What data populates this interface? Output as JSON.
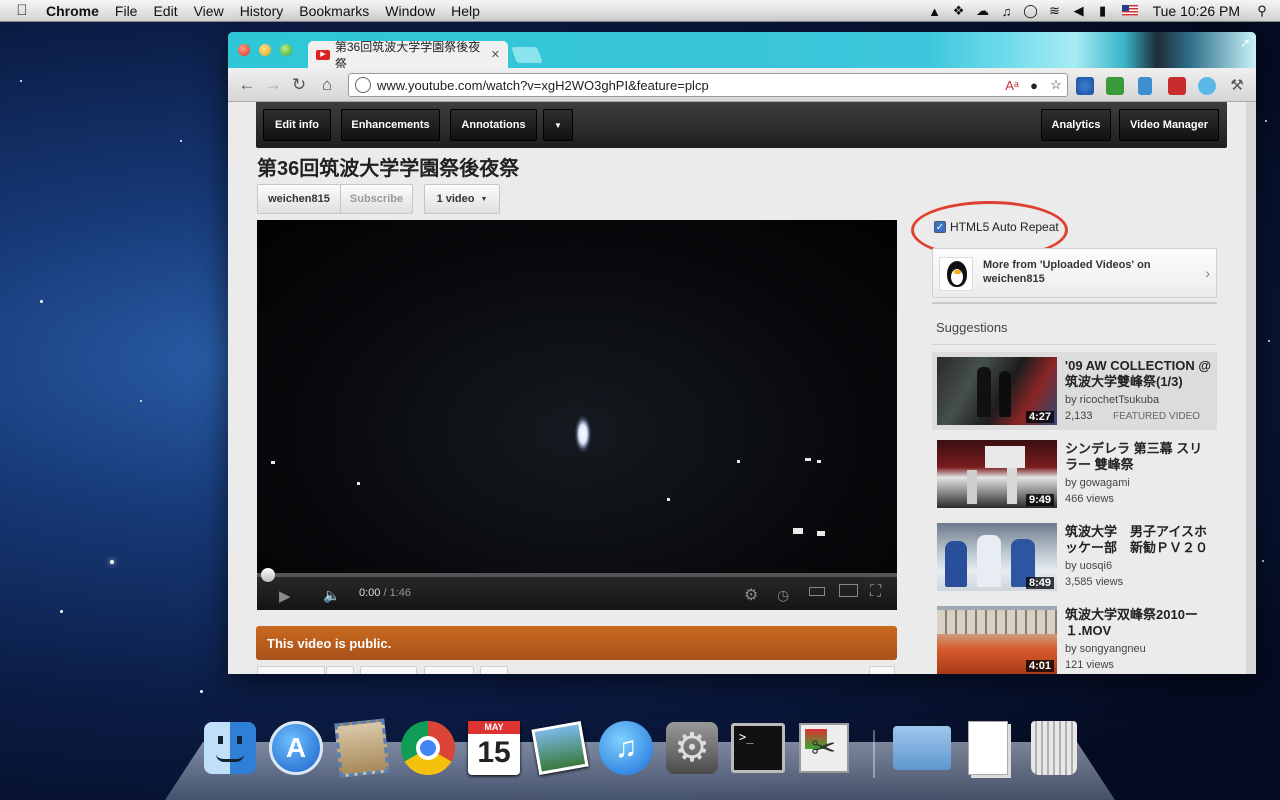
{
  "menubar": {
    "app_name": "Chrome",
    "items": [
      "File",
      "Edit",
      "View",
      "History",
      "Bookmarks",
      "Window",
      "Help"
    ],
    "clock": "Tue 10:26 PM",
    "status_icons": [
      "google-drive-icon",
      "dropbox-icon",
      "cloud-icon",
      "itunes-icon",
      "chat-bubble-icon",
      "wifi-icon",
      "volume-icon",
      "battery-icon",
      "flag-icon",
      "spotlight-icon"
    ]
  },
  "browser": {
    "tab_title": "第36回筑波大学学園祭後夜祭",
    "url": "www.youtube.com/watch?v=xgH2WO3ghPI&feature=plcp"
  },
  "owner_bar": {
    "edit_info": "Edit info",
    "enhancements": "Enhancements",
    "annotations": "Annotations",
    "analytics": "Analytics",
    "video_manager": "Video Manager"
  },
  "video": {
    "title": "第36回筑波大学学園祭後夜祭",
    "uploader": "weichen815",
    "subscribe": "Subscribe",
    "video_count": "1 video",
    "time_current": "0:00",
    "time_total": " / 1:46",
    "progress": 0.0,
    "public_notice": "This video is public."
  },
  "sidebar": {
    "auto_repeat_label": "HTML5 Auto Repeat",
    "auto_repeat_checked": true,
    "more_from": "More from 'Uploaded Videos' on weichen815",
    "suggestions_heading": "Suggestions",
    "suggestions": [
      {
        "title": "'09 AW COLLECTION @ 筑波大学雙峰祭(1/3)",
        "by": "by ricochetTsukuba",
        "views": "2,133",
        "badge": "FEATURED VIDEO",
        "duration": "4:27"
      },
      {
        "title": "シンデレラ 第三幕 スリラー 雙峰祭",
        "by": "by gowagami",
        "views": "466 views",
        "badge": "",
        "duration": "9:49"
      },
      {
        "title": "筑波大学　男子アイスホッケー部　新勧ＰＶ２０",
        "by": "by uosqi6",
        "views": "3,585 views",
        "badge": "",
        "duration": "8:49"
      },
      {
        "title": "筑波大学双峰祭2010ー１.MOV",
        "by": "by songyangneu",
        "views": "121 views",
        "badge": "",
        "duration": "4:01"
      }
    ]
  },
  "colors": {
    "tab_strip": "#2ec7d6",
    "owner_bar": "#2a2a2a",
    "public_banner": "#b85d1c",
    "highlight_circle": "#e0402f"
  },
  "dock": {
    "apps": [
      "finder-icon",
      "app-store-icon",
      "mail-icon",
      "chrome-icon",
      "calendar-icon",
      "iphoto-icon",
      "itunes-icon",
      "system-preferences-icon",
      "terminal-icon",
      "grab-icon",
      "documents-folder-icon",
      "document-stack-icon",
      "trash-icon"
    ],
    "calendar_month": "MAY",
    "calendar_day": "15"
  }
}
